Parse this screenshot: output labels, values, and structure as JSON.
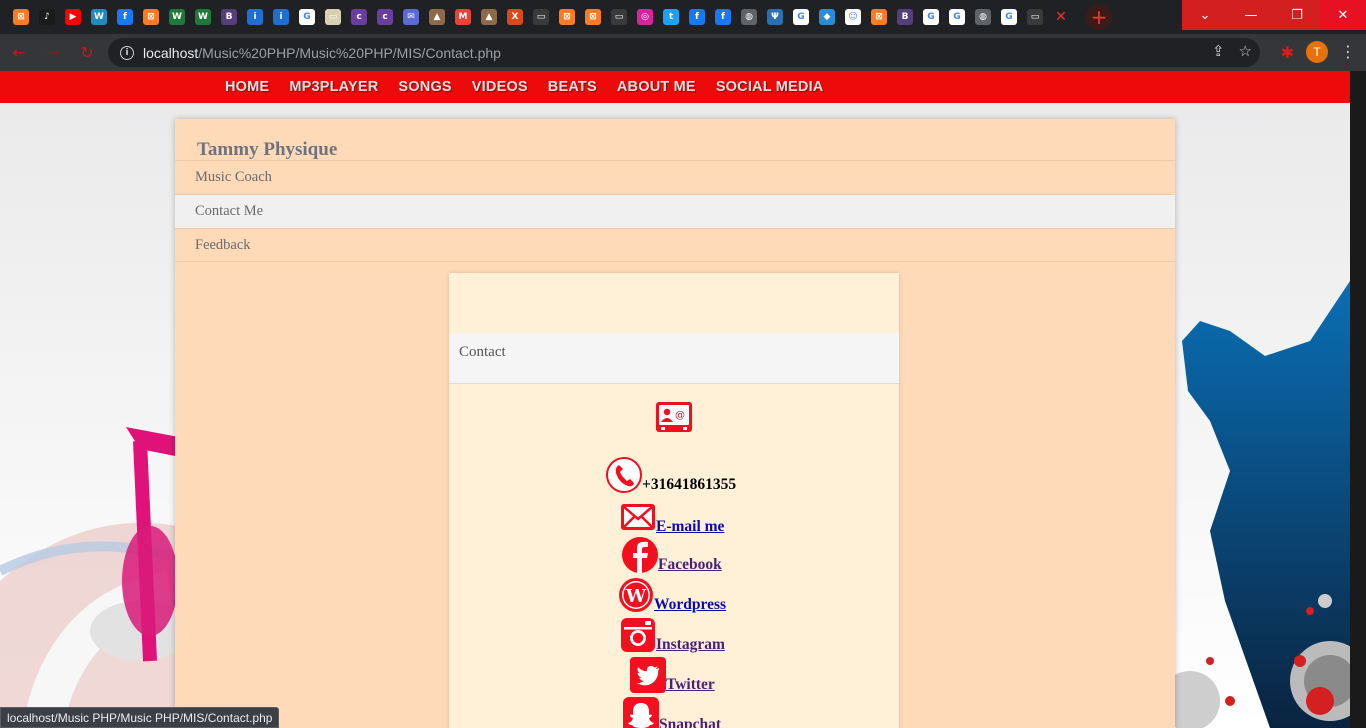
{
  "browser": {
    "tab_favicons": [
      {
        "name": "xampp",
        "color": "#fb7a24",
        "glyph": "⊠"
      },
      {
        "name": "music-note",
        "color": "#1b1b1b",
        "glyph": "♪"
      },
      {
        "name": "youtube",
        "color": "#ff0000",
        "glyph": "▶"
      },
      {
        "name": "wordpress",
        "color": "#1e8cbe",
        "glyph": "W"
      },
      {
        "name": "facebook",
        "color": "#1877f2",
        "glyph": "f"
      },
      {
        "name": "xampp",
        "color": "#fb7a24",
        "glyph": "⊠"
      },
      {
        "name": "webflow",
        "color": "#1f7a3a",
        "glyph": "W"
      },
      {
        "name": "webflow",
        "color": "#1f7a3a",
        "glyph": "W"
      },
      {
        "name": "bootstrap",
        "color": "#563d7c",
        "glyph": "B"
      },
      {
        "name": "info",
        "color": "#1f6fd1",
        "glyph": "i"
      },
      {
        "name": "info",
        "color": "#1f6fd1",
        "glyph": "i"
      },
      {
        "name": "google",
        "color": "#ffffff",
        "glyph": "G"
      },
      {
        "name": "image",
        "color": "#d8d0b0",
        "glyph": "▭"
      },
      {
        "name": "colorlib",
        "color": "#6a3ea1",
        "glyph": "c"
      },
      {
        "name": "colorlib",
        "color": "#6a3ea1",
        "glyph": "c"
      },
      {
        "name": "chat",
        "color": "#5b6bd6",
        "glyph": "✉"
      },
      {
        "name": "hat",
        "color": "#8c6a4a",
        "glyph": "▲"
      },
      {
        "name": "gmail",
        "color": "#ea4335",
        "glyph": "M"
      },
      {
        "name": "hat",
        "color": "#8c6a4a",
        "glyph": "▲"
      },
      {
        "name": "xt",
        "color": "#d94a1a",
        "glyph": "X"
      },
      {
        "name": "dark-page",
        "color": "#3a3a3a",
        "glyph": "▭"
      },
      {
        "name": "xampp",
        "color": "#fb7a24",
        "glyph": "⊠"
      },
      {
        "name": "xampp",
        "color": "#fb7a24",
        "glyph": "⊠"
      },
      {
        "name": "dark-page",
        "color": "#3a3a3a",
        "glyph": "▭"
      },
      {
        "name": "instagram",
        "color": "#d6249f",
        "glyph": "◎"
      },
      {
        "name": "twitter",
        "color": "#1da1f2",
        "glyph": "t"
      },
      {
        "name": "facebook",
        "color": "#1877f2",
        "glyph": "f"
      },
      {
        "name": "facebook",
        "color": "#1877f2",
        "glyph": "f"
      },
      {
        "name": "globe",
        "color": "#5f6368",
        "glyph": "◍"
      },
      {
        "name": "psi",
        "color": "#2a6fb0",
        "glyph": "Ψ"
      },
      {
        "name": "google",
        "color": "#ffffff",
        "glyph": "G"
      },
      {
        "name": "diamond",
        "color": "#2a8bd6",
        "glyph": "◆"
      },
      {
        "name": "snapchat",
        "color": "#ffffff",
        "glyph": "☺"
      },
      {
        "name": "xampp",
        "color": "#fb7a24",
        "glyph": "⊠"
      },
      {
        "name": "bootstrap",
        "color": "#563d7c",
        "glyph": "B"
      },
      {
        "name": "google",
        "color": "#ffffff",
        "glyph": "G"
      },
      {
        "name": "google",
        "color": "#ffffff",
        "glyph": "G"
      },
      {
        "name": "globe",
        "color": "#5f6368",
        "glyph": "◍"
      },
      {
        "name": "google",
        "color": "#ffffff",
        "glyph": "G"
      },
      {
        "name": "dark-page",
        "color": "#3a3a3a",
        "glyph": "▭"
      }
    ],
    "active_tab_close": "✕",
    "new_tab": "+",
    "window_controls": {
      "dropdown": "⌄",
      "minimize": "—",
      "restore": "❐",
      "close": "✕"
    },
    "nav": {
      "back": "←",
      "forward": "→",
      "reload": "↻"
    },
    "url_host": "localhost",
    "url_path": "/Music%20PHP/Music%20PHP/MIS/Contact.php",
    "avatar_letter": "T",
    "status_url": "localhost/Music PHP/Music PHP/MIS/Contact.php"
  },
  "site": {
    "nav": [
      "HOME",
      "MP3PLAYER",
      "SONGS",
      "VIDEOS",
      "BEATS",
      "ABOUT ME",
      "SOCIAL MEDIA"
    ],
    "brand": "Tammy Physique",
    "menu": [
      {
        "label": "Music Coach",
        "active": false
      },
      {
        "label": "Contact Me",
        "active": true
      },
      {
        "label": "Feedback",
        "active": false
      }
    ],
    "card_title": "Contact",
    "phone": "+31641861355",
    "links": {
      "email": "E-mail me",
      "facebook": "Facebook",
      "wordpress": "Wordpress",
      "instagram": "Instagram",
      "twitter": "Twitter",
      "snapchat": "Snapchat"
    },
    "accent": "#ee0a0a",
    "icon_red": "#f20f1f"
  }
}
